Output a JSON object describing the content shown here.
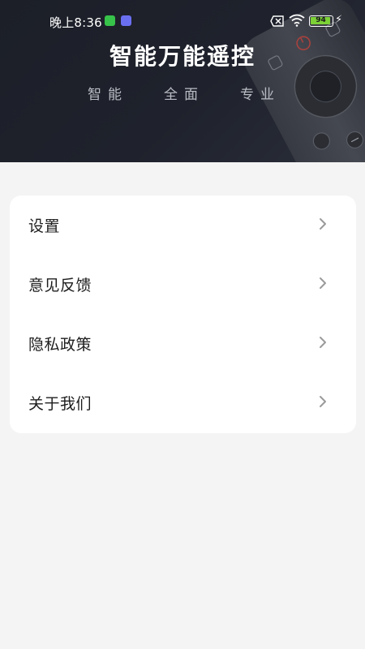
{
  "status_bar": {
    "time": "晚上8:36",
    "battery": "94",
    "icons": [
      "message-app-icon",
      "app-icon",
      "sim-blocked-icon",
      "wifi-icon",
      "battery-icon",
      "charging-bolt-icon"
    ],
    "colors": {
      "battery_fill": "#7cd136",
      "green_app": "#37c24a",
      "purple_app": "#6a6ff0"
    }
  },
  "banner": {
    "title": "智能万能遥控",
    "taglines": [
      "智能",
      "全面",
      "专业"
    ],
    "background": "#1f222c"
  },
  "menu": {
    "items": [
      {
        "label": "设置"
      },
      {
        "label": "意见反馈"
      },
      {
        "label": "隐私政策"
      },
      {
        "label": "关于我们"
      }
    ]
  }
}
